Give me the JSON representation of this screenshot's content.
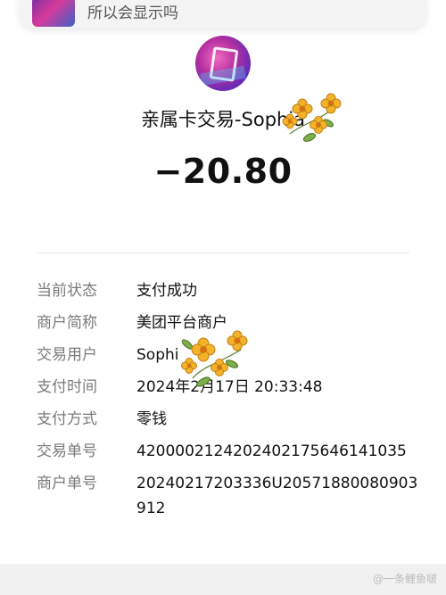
{
  "notification": {
    "text": "所以会显示吗"
  },
  "header": {
    "title": "亲属卡交易-Sophia",
    "amount": "−20.80"
  },
  "details": [
    {
      "label": "当前状态",
      "value": "支付成功"
    },
    {
      "label": "商户简称",
      "value": "美团平台商户"
    },
    {
      "label": "交易用户",
      "value": "Sophi"
    },
    {
      "label": "支付时间",
      "value": "2024年2月17日 20:33:48"
    },
    {
      "label": "支付方式",
      "value": "零钱"
    },
    {
      "label": "交易单号",
      "value": "4200002124202402175646141035"
    },
    {
      "label": "商户单号",
      "value": "20240217203336U20571880080903912"
    }
  ],
  "footer": {
    "watermark": "@一条鲤鱼啵"
  },
  "colors": {
    "label": "#7a7a7a",
    "value": "#111111",
    "flower": "#f2b32a"
  }
}
